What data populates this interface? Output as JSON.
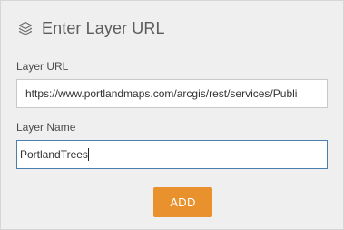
{
  "header": {
    "title": "Enter Layer URL",
    "icon": "layers-icon"
  },
  "layer_url": {
    "label": "Layer URL",
    "value": "https://www.portlandmaps.com/arcgis/rest/services/Publi"
  },
  "layer_name": {
    "label": "Layer Name",
    "value": "PortlandTrees"
  },
  "actions": {
    "add_label": "ADD"
  },
  "colors": {
    "accent": "#e8912d",
    "focus_border": "#4a7fb0",
    "panel_bg": "#efefef"
  }
}
